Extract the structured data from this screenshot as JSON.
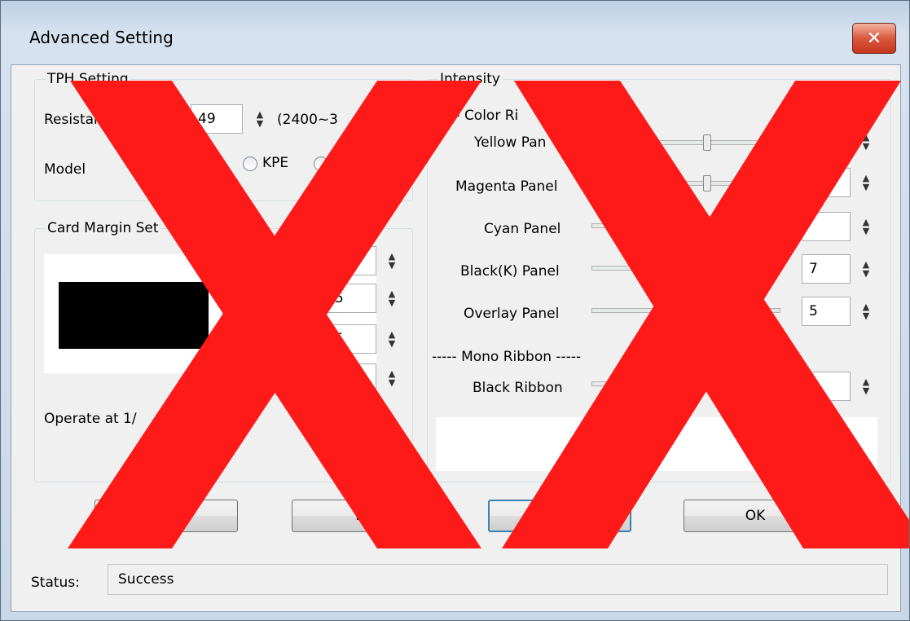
{
  "window": {
    "title": "Advanced Setting",
    "close_icon": "close-icon"
  },
  "tph": {
    "group_label": "TPH Setting",
    "resistance_label": "Resistan",
    "resistance_value": "49",
    "resistance_range": "(2400~3",
    "model_label": "Model",
    "model_option_kpe": "KPE"
  },
  "card_margin": {
    "group_label": "Card Margin Set",
    "fields": [
      "",
      "5",
      "5",
      ""
    ],
    "operate_label": "Operate at 1/"
  },
  "intensity": {
    "group_label": "Intensity",
    "color_ribbon_header": "---- Color Ri",
    "panels": [
      {
        "label": "Yellow Pan",
        "value": "",
        "level": 0.6
      },
      {
        "label": "Magenta Panel",
        "value": "",
        "level": 0.6
      },
      {
        "label": "Cyan Panel",
        "value": "",
        "level": 0.6
      },
      {
        "label": "Black(K) Panel",
        "value": "7",
        "level": 0.6
      },
      {
        "label": "Overlay Panel",
        "value": "5",
        "level": 0.6
      }
    ],
    "mono_ribbon_header": "----- Mono Ribbon -----",
    "black_ribbon": {
      "label": "Black Ribbon",
      "value": "5",
      "level": 0.6
    }
  },
  "buttons": {
    "b1": "",
    "b2": "Lo",
    "b3": "",
    "ok": "OK"
  },
  "status": {
    "label": "Status:",
    "value": "Success"
  },
  "overlay": {
    "mark": "red-x-marks",
    "color": "#ff1a1a"
  }
}
